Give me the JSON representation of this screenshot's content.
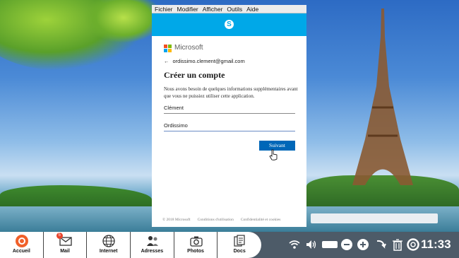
{
  "menubar": {
    "items": [
      "Fichier",
      "Modifier",
      "Afficher",
      "Outils",
      "Aide"
    ]
  },
  "signup": {
    "brand": "Microsoft",
    "account_email": "ordissimo.clement@gmail.com",
    "heading": "Créer un compte",
    "description": "Nous avons besoin de quelques informations supplémentaires avant que vous ne puissiez utiliser cette application.",
    "first_name_value": "Clément",
    "last_name_value": "Ordissimo",
    "next_label": "Suivant",
    "footer": [
      "© 2018 Microsoft",
      "Conditions d'utilisation",
      "Confidentialité et cookies"
    ]
  },
  "dock": {
    "items": [
      {
        "label": "Accueil",
        "icon": "home-icon"
      },
      {
        "label": "Mail",
        "icon": "mail-icon",
        "badge": "5"
      },
      {
        "label": "Internet",
        "icon": "globe-icon"
      },
      {
        "label": "Adresses",
        "icon": "contacts-icon"
      },
      {
        "label": "Photos",
        "icon": "camera-icon"
      },
      {
        "label": "Docs",
        "icon": "documents-icon"
      }
    ]
  },
  "tray": {
    "icons": [
      "wifi-icon",
      "volume-icon",
      "zoom-out-icon",
      "zoom-in-icon",
      "refresh-icon",
      "trash-icon",
      "help-icon"
    ],
    "time": "11:33"
  },
  "colors": {
    "skype_header": "#00a8e8",
    "button": "#0067b8",
    "taskbar": "#4d5b68"
  }
}
